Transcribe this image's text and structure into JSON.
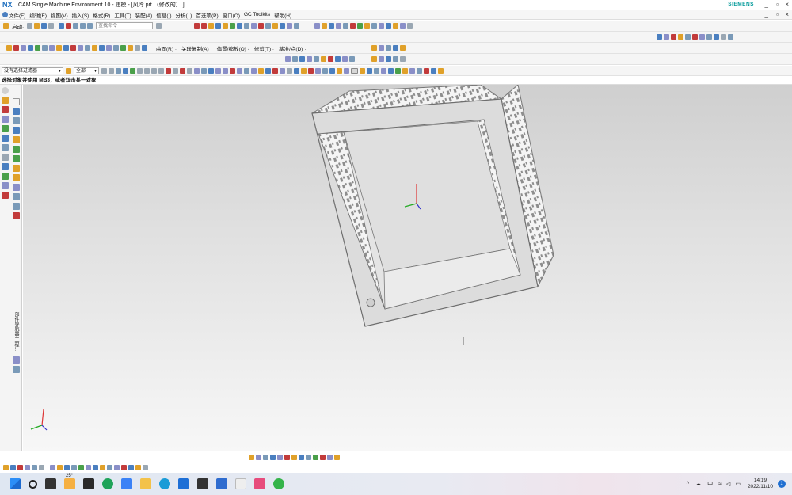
{
  "window": {
    "logo": "NX",
    "title": "CAM Single Machine Environment 10 - 建模 - [风冷.prt （修改的） ]",
    "brand": "SIEMENS",
    "controls": [
      "_",
      "▫",
      "×"
    ],
    "inner_controls": [
      "_",
      "▫",
      "×"
    ]
  },
  "menu": {
    "items": [
      "文件(F)",
      "编辑(E)",
      "视图(V)",
      "插入(S)",
      "格式(R)",
      "工具(T)",
      "装配(A)",
      "信息(I)",
      "分析(L)",
      "首选项(P)",
      "窗口(O)",
      "GC Toolkits",
      "帮助(H)"
    ]
  },
  "toolbar1": {
    "start_label": "启动·",
    "search_placeholder": "查找命令"
  },
  "toolbar2": {
    "labels": [
      "曲面(R) ·",
      "关联复制(A) ·",
      "偏置/缩放(O) ·",
      "修剪(T) ·",
      "基准/点(D) ·"
    ]
  },
  "toolbar3": {
    "filter_value": "没有选择过滤器",
    "scope_value": "全部"
  },
  "status": {
    "prompt": "选择对象并使用 MB3，或者双击某一对象"
  },
  "sidebar": {
    "vertical_label": "部件导航器·工程..."
  },
  "taskbar": {
    "weather": "25°",
    "ime": "中",
    "time": "14:19",
    "date": "2022/11/10",
    "notification_count": "1"
  }
}
